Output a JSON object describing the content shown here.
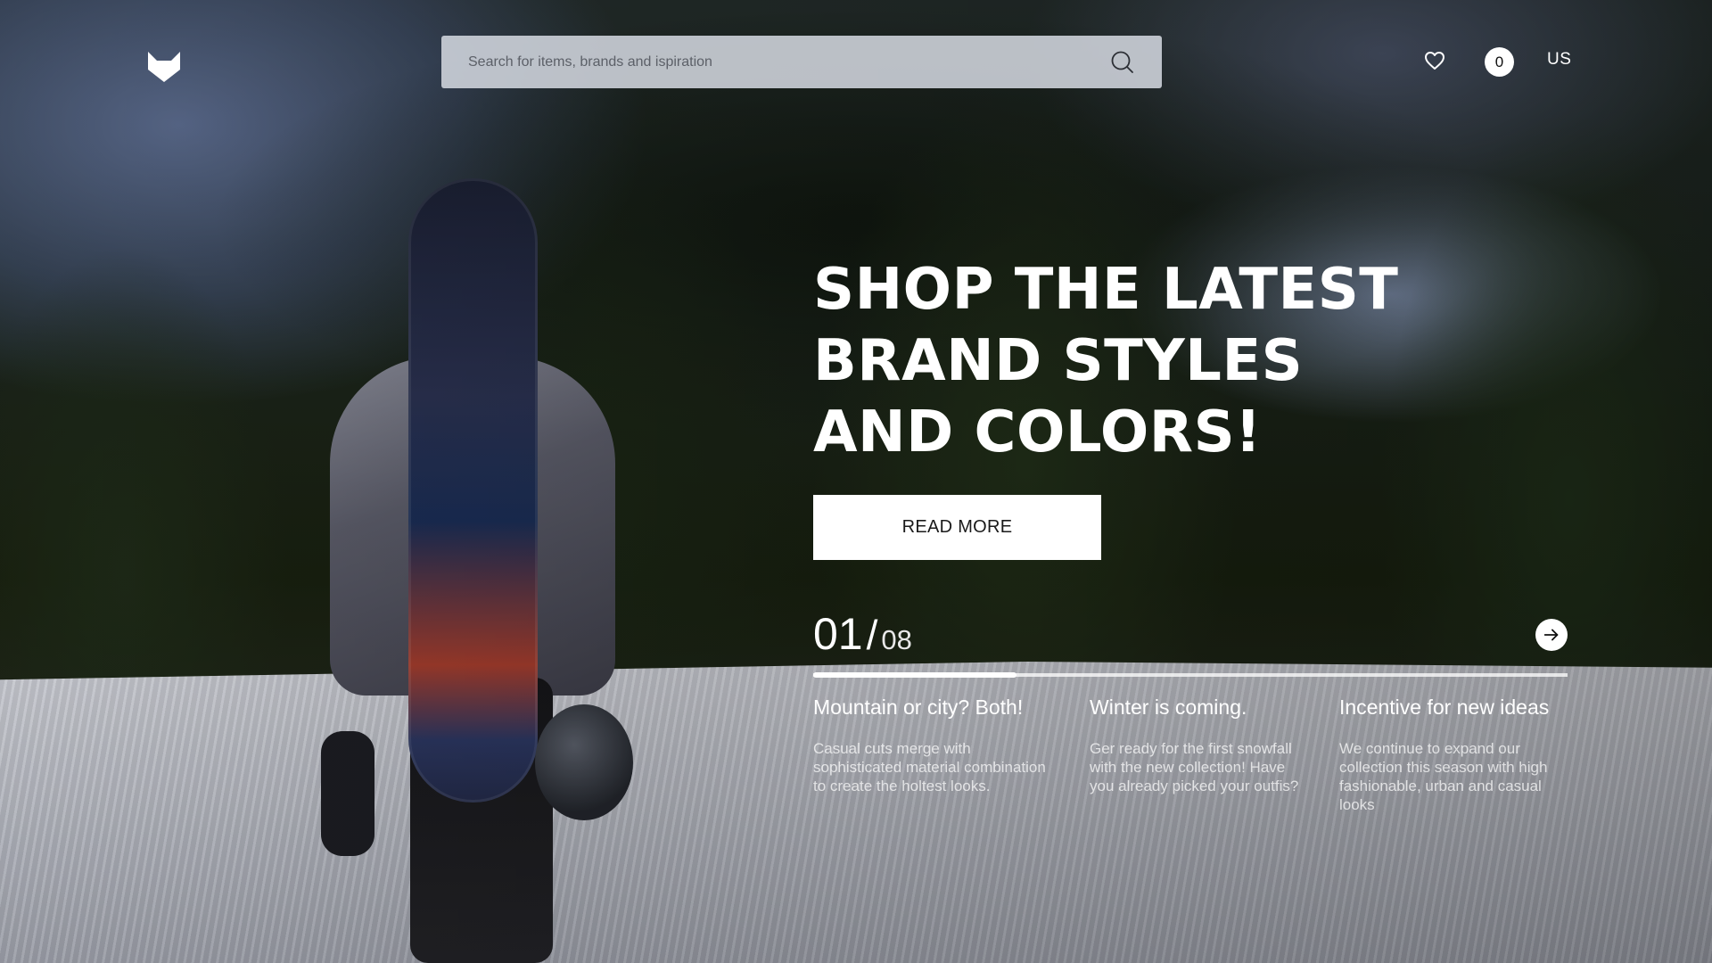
{
  "header": {
    "logo_icon": "fox-logo-icon",
    "search": {
      "placeholder": "Search for items, brands and ispiration",
      "icon": "search-icon"
    },
    "wishlist_icon": "heart-icon",
    "cart_count": "0",
    "locale": "US"
  },
  "hero": {
    "headline_lines": [
      "SHOP THE LATEST",
      "BRAND STYLES",
      "AND COLORS!"
    ],
    "cta_label": "READ MORE",
    "slide_current": "01",
    "slide_separator": "/",
    "slide_total": "08",
    "slide_progress": 0.27,
    "next_icon": "arrow-right-icon"
  },
  "features": [
    {
      "title": "Mountain or city? Both!",
      "text": "Casual cuts merge with sophisticated material combination to create the holtest looks."
    },
    {
      "title": "Winter is coming.",
      "text": "Ger ready for the first snowfall with the new collection! Have you already picked your outfis?"
    },
    {
      "title": "Incentive for new ideas",
      "text": "We continue to expand our collection this season with high fashionable, urban and casual looks"
    }
  ],
  "colors": {
    "search_bg": "#d2d6de",
    "button_bg": "#ffffff",
    "text": "#ffffff"
  }
}
